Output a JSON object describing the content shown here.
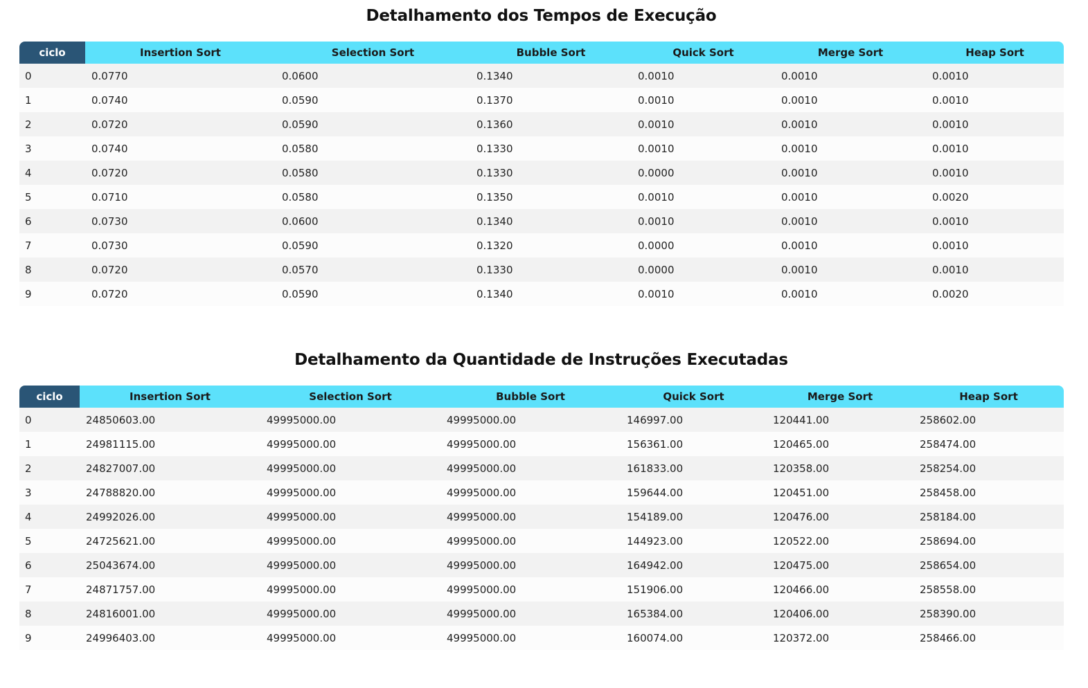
{
  "tables": [
    {
      "title": "Detalhamento dos Tempos de Execução",
      "headers": [
        "ciclo",
        "Insertion Sort",
        "Selection Sort",
        "Bubble Sort",
        "Quick Sort",
        "Merge Sort",
        "Heap Sort"
      ],
      "rows": [
        [
          "0",
          "0.0770",
          "0.0600",
          "0.1340",
          "0.0010",
          "0.0010",
          "0.0010"
        ],
        [
          "1",
          "0.0740",
          "0.0590",
          "0.1370",
          "0.0010",
          "0.0010",
          "0.0010"
        ],
        [
          "2",
          "0.0720",
          "0.0590",
          "0.1360",
          "0.0010",
          "0.0010",
          "0.0010"
        ],
        [
          "3",
          "0.0740",
          "0.0580",
          "0.1330",
          "0.0010",
          "0.0010",
          "0.0010"
        ],
        [
          "4",
          "0.0720",
          "0.0580",
          "0.1330",
          "0.0000",
          "0.0010",
          "0.0010"
        ],
        [
          "5",
          "0.0710",
          "0.0580",
          "0.1350",
          "0.0010",
          "0.0010",
          "0.0020"
        ],
        [
          "6",
          "0.0730",
          "0.0600",
          "0.1340",
          "0.0010",
          "0.0010",
          "0.0010"
        ],
        [
          "7",
          "0.0730",
          "0.0590",
          "0.1320",
          "0.0000",
          "0.0010",
          "0.0010"
        ],
        [
          "8",
          "0.0720",
          "0.0570",
          "0.1330",
          "0.0000",
          "0.0010",
          "0.0010"
        ],
        [
          "9",
          "0.0720",
          "0.0590",
          "0.1340",
          "0.0010",
          "0.0010",
          "0.0020"
        ]
      ]
    },
    {
      "title": "Detalhamento da Quantidade de Instruções Executadas",
      "headers": [
        "ciclo",
        "Insertion Sort",
        "Selection Sort",
        "Bubble Sort",
        "Quick Sort",
        "Merge Sort",
        "Heap Sort"
      ],
      "rows": [
        [
          "0",
          "24850603.00",
          "49995000.00",
          "49995000.00",
          "146997.00",
          "120441.00",
          "258602.00"
        ],
        [
          "1",
          "24981115.00",
          "49995000.00",
          "49995000.00",
          "156361.00",
          "120465.00",
          "258474.00"
        ],
        [
          "2",
          "24827007.00",
          "49995000.00",
          "49995000.00",
          "161833.00",
          "120358.00",
          "258254.00"
        ],
        [
          "3",
          "24788820.00",
          "49995000.00",
          "49995000.00",
          "159644.00",
          "120451.00",
          "258458.00"
        ],
        [
          "4",
          "24992026.00",
          "49995000.00",
          "49995000.00",
          "154189.00",
          "120476.00",
          "258184.00"
        ],
        [
          "5",
          "24725621.00",
          "49995000.00",
          "49995000.00",
          "144923.00",
          "120522.00",
          "258694.00"
        ],
        [
          "6",
          "25043674.00",
          "49995000.00",
          "49995000.00",
          "164942.00",
          "120475.00",
          "258654.00"
        ],
        [
          "7",
          "24871757.00",
          "49995000.00",
          "49995000.00",
          "151906.00",
          "120466.00",
          "258558.00"
        ],
        [
          "8",
          "24816001.00",
          "49995000.00",
          "49995000.00",
          "165384.00",
          "120406.00",
          "258390.00"
        ],
        [
          "9",
          "24996403.00",
          "49995000.00",
          "49995000.00",
          "160074.00",
          "120372.00",
          "258466.00"
        ]
      ]
    }
  ]
}
